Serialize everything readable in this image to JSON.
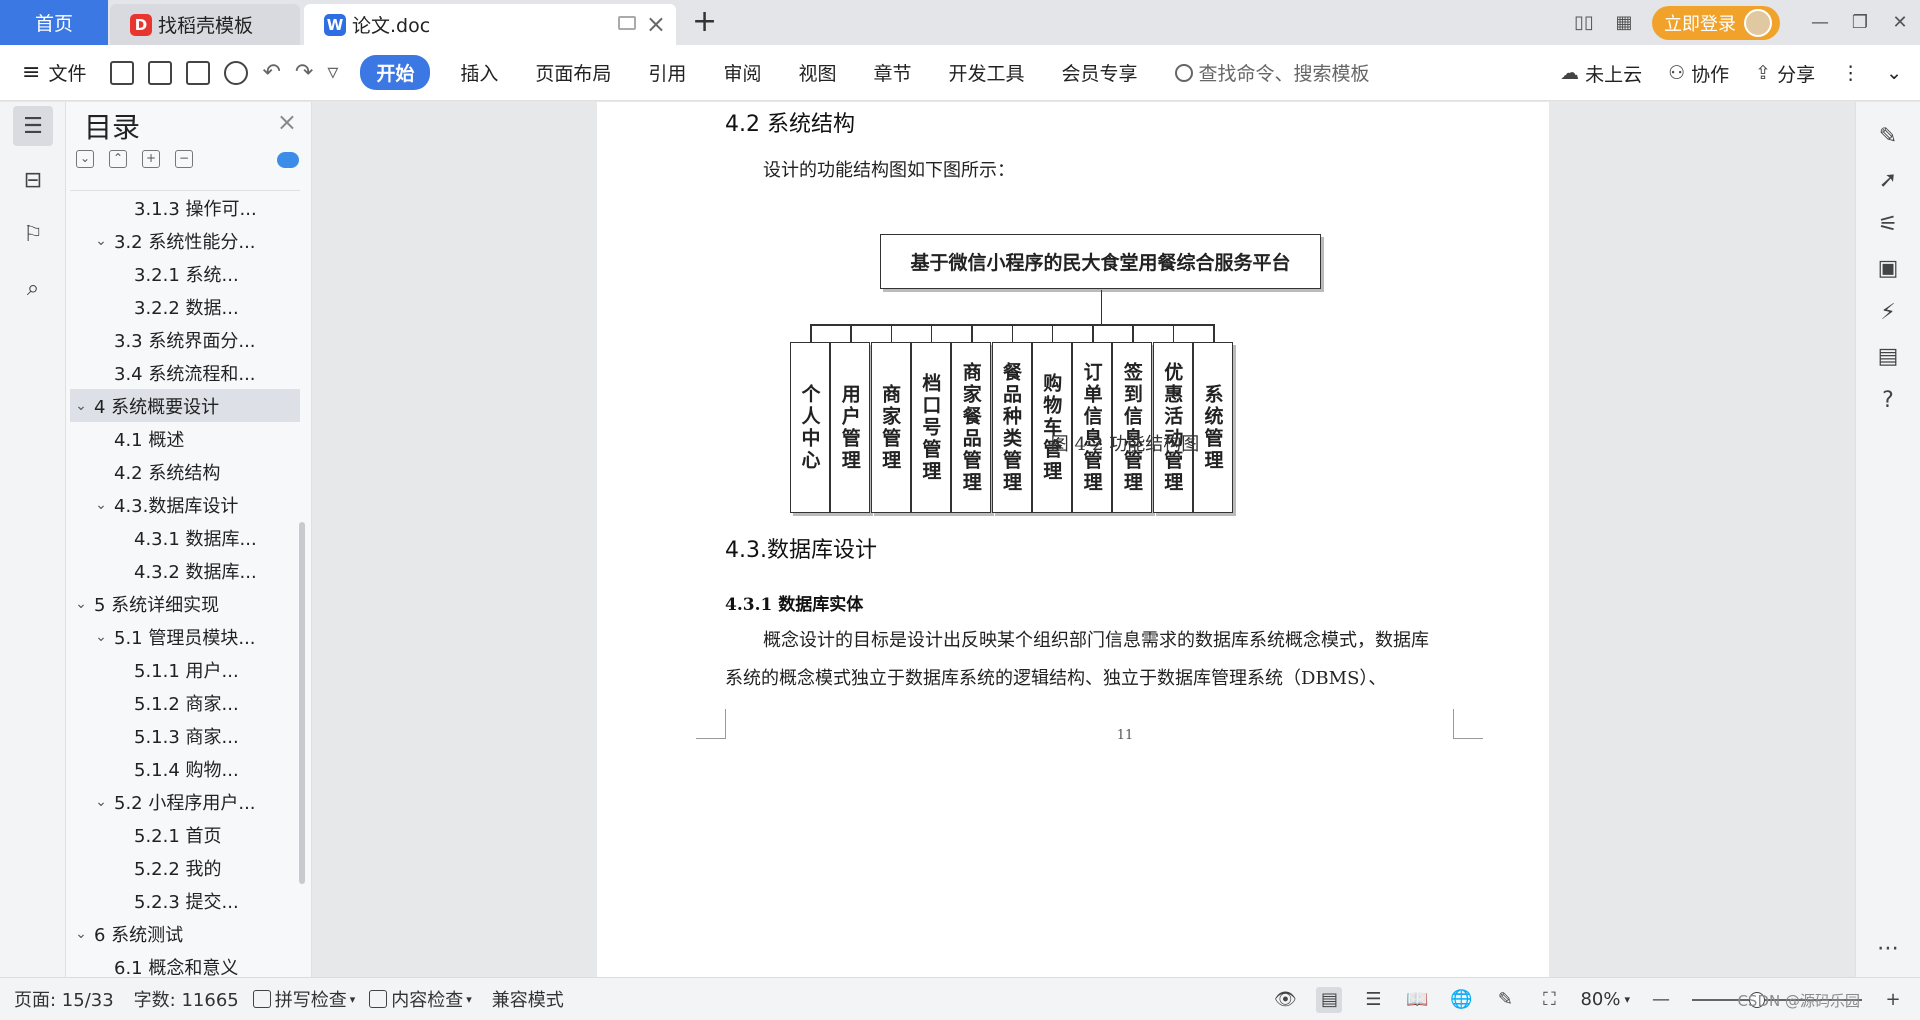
{
  "tabs": {
    "home": "首页",
    "templates": "找稻壳模板",
    "document": "论文.doc"
  },
  "window": {
    "login": "立即登录"
  },
  "menu": {
    "file": "文件",
    "tabs": [
      "开始",
      "插入",
      "页面布局",
      "引用",
      "审阅",
      "视图",
      "章节",
      "开发工具",
      "会员专享"
    ],
    "search": "查找命令、搜索模板",
    "cloud": "未上云",
    "collab": "协作",
    "share": "分享"
  },
  "toc": {
    "title": "目录",
    "items": [
      {
        "label": "3.1.3 操作可...",
        "level": 3,
        "chev": ""
      },
      {
        "label": "3.2 系统性能分...",
        "level": 2,
        "chev": "v"
      },
      {
        "label": "3.2.1 系统...",
        "level": 3,
        "chev": ""
      },
      {
        "label": "3.2.2 数据...",
        "level": 3,
        "chev": ""
      },
      {
        "label": "3.3 系统界面分...",
        "level": 2,
        "chev": ""
      },
      {
        "label": "3.4 系统流程和...",
        "level": 2,
        "chev": ""
      },
      {
        "label": "4 系统概要设计",
        "level": 1,
        "chev": "v",
        "selected": true
      },
      {
        "label": "4.1 概述",
        "level": 2,
        "chev": ""
      },
      {
        "label": "4.2 系统结构",
        "level": 2,
        "chev": ""
      },
      {
        "label": "4.3.数据库设计",
        "level": 2,
        "chev": "v"
      },
      {
        "label": "4.3.1 数据库...",
        "level": 3,
        "chev": ""
      },
      {
        "label": "4.3.2 数据库...",
        "level": 3,
        "chev": ""
      },
      {
        "label": "5 系统详细实现",
        "level": 1,
        "chev": "v"
      },
      {
        "label": "5.1 管理员模块...",
        "level": 2,
        "chev": "v"
      },
      {
        "label": "5.1.1 用户...",
        "level": 3,
        "chev": ""
      },
      {
        "label": "5.1.2 商家...",
        "level": 3,
        "chev": ""
      },
      {
        "label": "5.1.3 商家...",
        "level": 3,
        "chev": ""
      },
      {
        "label": "5.1.4 购物...",
        "level": 3,
        "chev": ""
      },
      {
        "label": "5.2 小程序用户...",
        "level": 2,
        "chev": "v"
      },
      {
        "label": "5.2.1 首页",
        "level": 3,
        "chev": ""
      },
      {
        "label": "5.2.2 我的",
        "level": 3,
        "chev": ""
      },
      {
        "label": "5.2.3 提交...",
        "level": 3,
        "chev": ""
      },
      {
        "label": "6 系统测试",
        "level": 1,
        "chev": "v"
      },
      {
        "label": "6.1 概念和意义",
        "level": 2,
        "chev": ""
      }
    ]
  },
  "doc": {
    "heading_42": "4.2 系统结构",
    "intro": "设计的功能结构图如下图所示：",
    "diagram_root": "基于微信小程序的民大食堂用餐综合服务平台",
    "diagram_leaves": [
      "个人中心",
      "用户管理",
      "商家管理",
      "档口号管理",
      "商家餐品管理",
      "餐品种类管理",
      "购物车管理",
      "订单信息管理",
      "签到信息管理",
      "优惠活动管理",
      "系统管理"
    ],
    "caption": "图 4-2 功能结构图",
    "heading_43": "4.3.数据库设计",
    "heading_431": "4.3.1 数据库实体",
    "paragraph": "概念设计的目标是设计出反映某个组织部门信息需求的数据库系统概念模式，数据库系统的概念模式独立于数据库系统的逻辑结构、独立于数据库管理系统（DBMS）、",
    "page_number": "11"
  },
  "status": {
    "page": "页面: 15/33",
    "words": "字数: 11665",
    "spell": "拼写检查",
    "content_check": "内容检查",
    "compat": "兼容模式",
    "zoom": "80%",
    "zoom_fraction": 0.38,
    "watermark": "CSDN @源码乐园"
  },
  "colors": {
    "accent": "#3c78e3",
    "login": "#f0a22a"
  }
}
